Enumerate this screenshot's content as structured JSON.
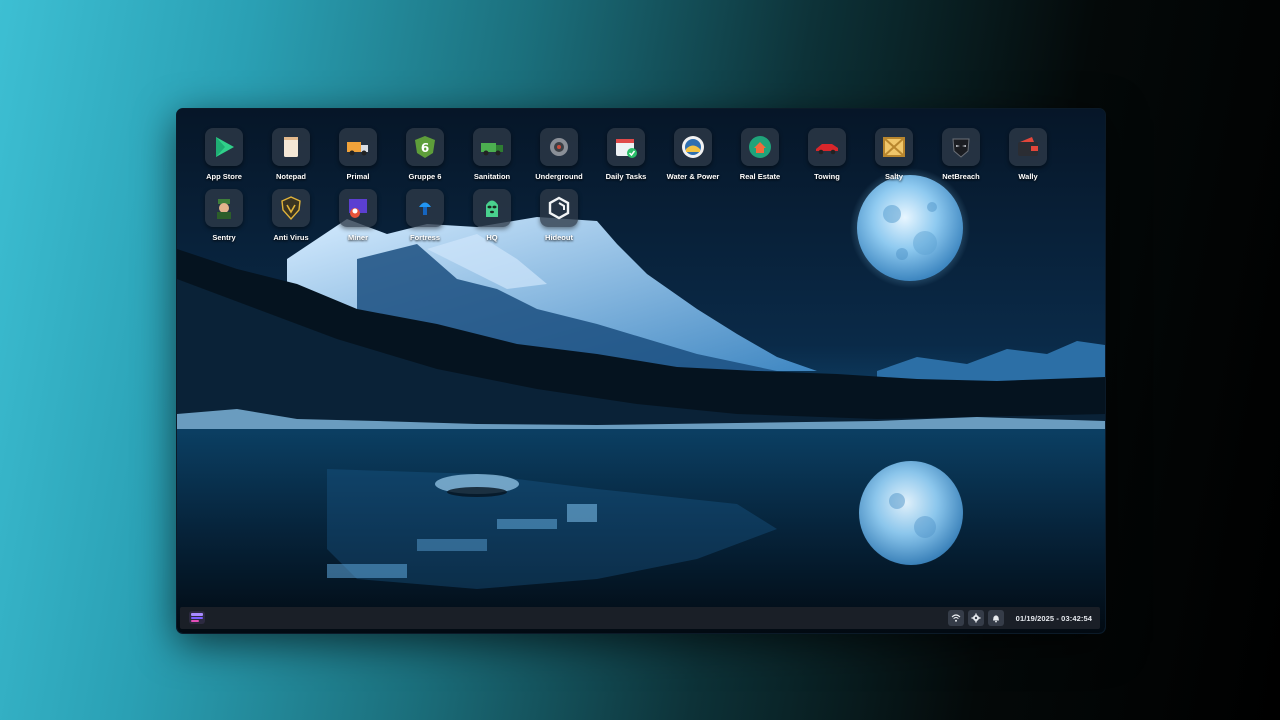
{
  "desktop": {
    "apps": [
      {
        "label": "App Store",
        "icon": "play-triangle-icon"
      },
      {
        "label": "Notepad",
        "icon": "notepad-icon"
      },
      {
        "label": "Primal",
        "icon": "delivery-truck-icon"
      },
      {
        "label": "Gruppe 6",
        "icon": "gruppe6-shield-icon"
      },
      {
        "label": "Sanitation",
        "icon": "garbage-truck-icon"
      },
      {
        "label": "Underground",
        "icon": "underground-icon"
      },
      {
        "label": "Daily Tasks",
        "icon": "calendar-check-icon"
      },
      {
        "label": "Water & Power",
        "icon": "water-power-icon"
      },
      {
        "label": "Real Estate",
        "icon": "real-estate-icon"
      },
      {
        "label": "Towing",
        "icon": "tow-truck-icon"
      },
      {
        "label": "Salty",
        "icon": "crate-icon"
      },
      {
        "label": "NetBreach",
        "icon": "hacker-mask-icon"
      },
      {
        "label": "Wally",
        "icon": "wallet-icon"
      },
      {
        "label": "Sentry",
        "icon": "sentry-character-icon"
      },
      {
        "label": "Anti Virus",
        "icon": "shield-icon"
      },
      {
        "label": "Miner",
        "icon": "miner-icon"
      },
      {
        "label": "Fortress",
        "icon": "fortress-icon"
      },
      {
        "label": "HQ",
        "icon": "balaclava-icon"
      },
      {
        "label": "Hideout",
        "icon": "hideout-logo-icon"
      }
    ]
  },
  "taskbar": {
    "start_icon": "start-menu-icon",
    "tray_icons": [
      "wifi-icon",
      "gear-icon",
      "bell-icon"
    ],
    "datetime": "01/19/2025 - 03:42:54"
  },
  "colors": {
    "accent_start": "#7a5cff",
    "taskbar_bg": "#1a1f27"
  }
}
